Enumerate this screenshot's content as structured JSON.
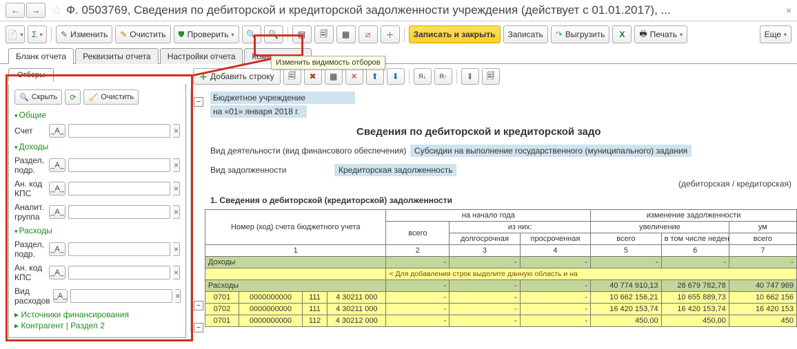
{
  "title": "Ф. 0503769, Сведения по дебиторской и кредиторской задолженности учреждения (действует с 01.01.2017), ...",
  "toolbar": {
    "edit": "Изменить",
    "clear": "Очистить",
    "check": "Проверить",
    "record_close": "Записать и закрыть",
    "write": "Записать",
    "export": "Выгрузить",
    "print": "Печать",
    "more": "Еще"
  },
  "tabs": {
    "t1": "Бланк отчета",
    "t2": "Реквизиты отчета",
    "t3": "Настройки отчета",
    "t4": "Комментарии"
  },
  "subtab": "Отборы",
  "filters": {
    "hide": "Скрыть",
    "clear": "Очистить",
    "grp_general": "Общие",
    "acct": "Счет",
    "grp_income": "Доходы",
    "razdel": "Раздел, подр.",
    "ankps": "Ан. код КПС",
    "analit": "Аналит. группа",
    "grp_expense": "Расходы",
    "vidrash": "Вид расходов",
    "src": "Источники финансирования",
    "contr": "Контрагент | Раздел 2",
    "a_label": "_А_"
  },
  "tooltip": "Изменить видимость отборов",
  "rpt": {
    "add_row": "Добавить строку"
  },
  "sheet": {
    "org": "Бюджетное учреждение",
    "date": "на «01» января 2018 г.",
    "title": "Сведения по дебиторской и кредиторской задо",
    "act_label": "Вид деятельности (вид финансового обеспечения)",
    "act_val": "Субсидии на выполнение государственного (муниципального) задания",
    "debt_label": "Вид задолженности",
    "debt_val": "Кредиторская задолженность",
    "debt_sub": "(дебиторская / кредиторская)",
    "section": "1. Сведения о дебиторской (кредиторской) задолженности"
  },
  "thead": {
    "col1": "Номер (код) счета бюджетного учета",
    "beg": "на начало года",
    "chg": "изменение задолженности",
    "total": "всего",
    "ofwhich": "из них:",
    "long": "долгосрочная",
    "over": "просроченная",
    "inc": "увеличение",
    "dec": "ум",
    "noncash": "в том числе неденежные расчеты",
    "n1": "1",
    "n2": "2",
    "n3": "3",
    "n4": "4",
    "n5": "5",
    "n6": "6",
    "n7": "7"
  },
  "rows": {
    "income": "Доходы",
    "hint": "< Для добавления строк выделите данную область и на",
    "expense": "Расходы",
    "r1": {
      "c": "0701",
      "acc": "0000000000",
      "k": "111",
      "cc": "4 30211 000",
      "v5": "10 662 156,21",
      "v6": "10 655 889,73",
      "v7": "10 662 156"
    },
    "r2": {
      "c": "0702",
      "acc": "0000000000",
      "k": "111",
      "cc": "4 30211 000",
      "v5": "16 420 153,74",
      "v6": "16 420 153,74",
      "v7": "16 420 153"
    },
    "r3": {
      "c": "0701",
      "acc": "0000000000",
      "k": "112",
      "cc": "4 30212 000",
      "v5": "450,00",
      "v6": "450,00",
      "v7": "450"
    },
    "exp_tot": {
      "v5": "40 774 910,13",
      "v6": "28 679 782,78",
      "v7": "40 747 969"
    }
  }
}
